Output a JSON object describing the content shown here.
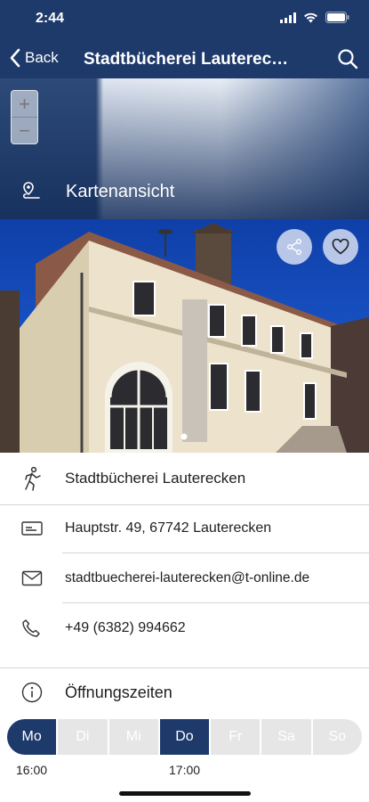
{
  "status_bar": {
    "time": "2:44"
  },
  "navbar": {
    "back_label": "Back",
    "title": "Stadtbücherei Lauterecken"
  },
  "map": {
    "zoom_in": "+",
    "zoom_out": "−",
    "map_view_label": "Kartenansicht"
  },
  "details": {
    "name": "Stadtbücherei Lauterecken",
    "address": "Hauptstr. 49, 67742 Lauterecken",
    "email": "stadtbuecherei-lauterecken@t-online.de",
    "phone": "+49 (6382) 994662"
  },
  "opening": {
    "heading": "Öffnungszeiten",
    "days": [
      {
        "label": "Mo",
        "active": true
      },
      {
        "label": "Di",
        "active": false
      },
      {
        "label": "Mi",
        "active": false
      },
      {
        "label": "Do",
        "active": true
      },
      {
        "label": "Fr",
        "active": false
      },
      {
        "label": "Sa",
        "active": false
      },
      {
        "label": "So",
        "active": false
      }
    ],
    "hours_mo": "16:00",
    "hours_do": "17:00"
  },
  "colors": {
    "primary": "#1d3a6b",
    "inactive_day": "#e6e6e6"
  }
}
